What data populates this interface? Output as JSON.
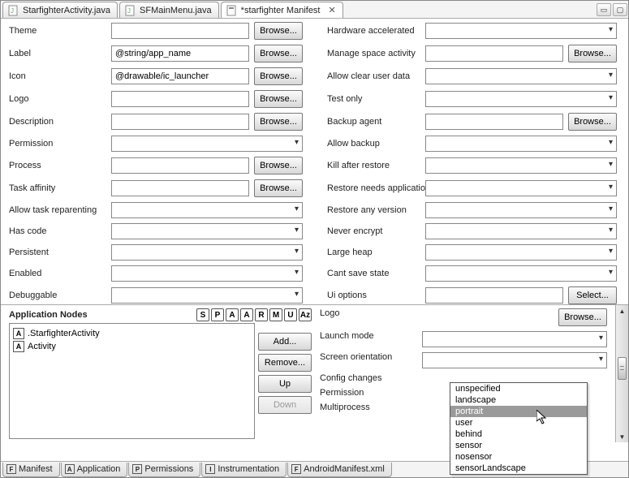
{
  "tabs": [
    {
      "label": "StarfighterActivity.java"
    },
    {
      "label": "SFMainMenu.java"
    },
    {
      "label": "*starfighter Manifest"
    }
  ],
  "leftFields": [
    {
      "label": "Theme",
      "value": "",
      "type": "browse"
    },
    {
      "label": "Label",
      "value": "@string/app_name",
      "type": "browse"
    },
    {
      "label": "Icon",
      "value": "@drawable/ic_launcher",
      "type": "browse"
    },
    {
      "label": "Logo",
      "value": "",
      "type": "browse"
    },
    {
      "label": "Description",
      "value": "",
      "type": "browse"
    },
    {
      "label": "Permission",
      "value": "",
      "type": "combo"
    },
    {
      "label": "Process",
      "value": "",
      "type": "browse"
    },
    {
      "label": "Task affinity",
      "value": "",
      "type": "browse"
    },
    {
      "label": "Allow task reparenting",
      "value": "",
      "type": "combo"
    },
    {
      "label": "Has code",
      "value": "",
      "type": "combo"
    },
    {
      "label": "Persistent",
      "value": "",
      "type": "combo"
    },
    {
      "label": "Enabled",
      "value": "",
      "type": "combo"
    },
    {
      "label": "Debuggable",
      "value": "",
      "type": "combo"
    }
  ],
  "rightFields": [
    {
      "label": "Hardware accelerated",
      "type": "combo"
    },
    {
      "label": "Manage space activity",
      "type": "browse"
    },
    {
      "label": "Allow clear user data",
      "type": "combo"
    },
    {
      "label": "Test only",
      "type": "combo"
    },
    {
      "label": "Backup agent",
      "type": "browse"
    },
    {
      "label": "Allow backup",
      "type": "combo"
    },
    {
      "label": "Kill after restore",
      "type": "combo"
    },
    {
      "label": "Restore needs application",
      "type": "combo"
    },
    {
      "label": "Restore any version",
      "type": "combo"
    },
    {
      "label": "Never encrypt",
      "type": "combo"
    },
    {
      "label": "Large heap",
      "type": "combo"
    },
    {
      "label": "Cant save state",
      "type": "combo"
    },
    {
      "label": "Ui options",
      "type": "select"
    }
  ],
  "browseLabel": "Browse...",
  "selectLabel": "Select...",
  "appNodes": {
    "title": "Application Nodes",
    "toolbarLetters": [
      "S",
      "P",
      "A",
      "A",
      "R",
      "M",
      "U",
      "Az"
    ],
    "items": [
      ".StarfighterActivity",
      "Activity"
    ],
    "buttons": {
      "add": "Add...",
      "remove": "Remove...",
      "up": "Up",
      "down": "Down"
    }
  },
  "rightLower": [
    {
      "label": "Logo",
      "type": "browse-only"
    },
    {
      "label": "Launch mode",
      "type": "combo"
    },
    {
      "label": "Screen orientation",
      "type": "combo-open"
    },
    {
      "label": "Config changes",
      "type": "none"
    },
    {
      "label": "Permission",
      "type": "none"
    },
    {
      "label": "Multiprocess",
      "type": "none"
    }
  ],
  "dropdown": {
    "items": [
      "unspecified",
      "landscape",
      "portrait",
      "user",
      "behind",
      "sensor",
      "nosensor",
      "sensorLandscape"
    ],
    "selected": "portrait"
  },
  "bottomTabs": [
    {
      "icon": "F",
      "label": "Manifest"
    },
    {
      "icon": "A",
      "label": "Application"
    },
    {
      "icon": "P",
      "label": "Permissions"
    },
    {
      "icon": "I",
      "label": "Instrumentation"
    },
    {
      "icon": "F",
      "label": "AndroidManifest.xml"
    }
  ]
}
